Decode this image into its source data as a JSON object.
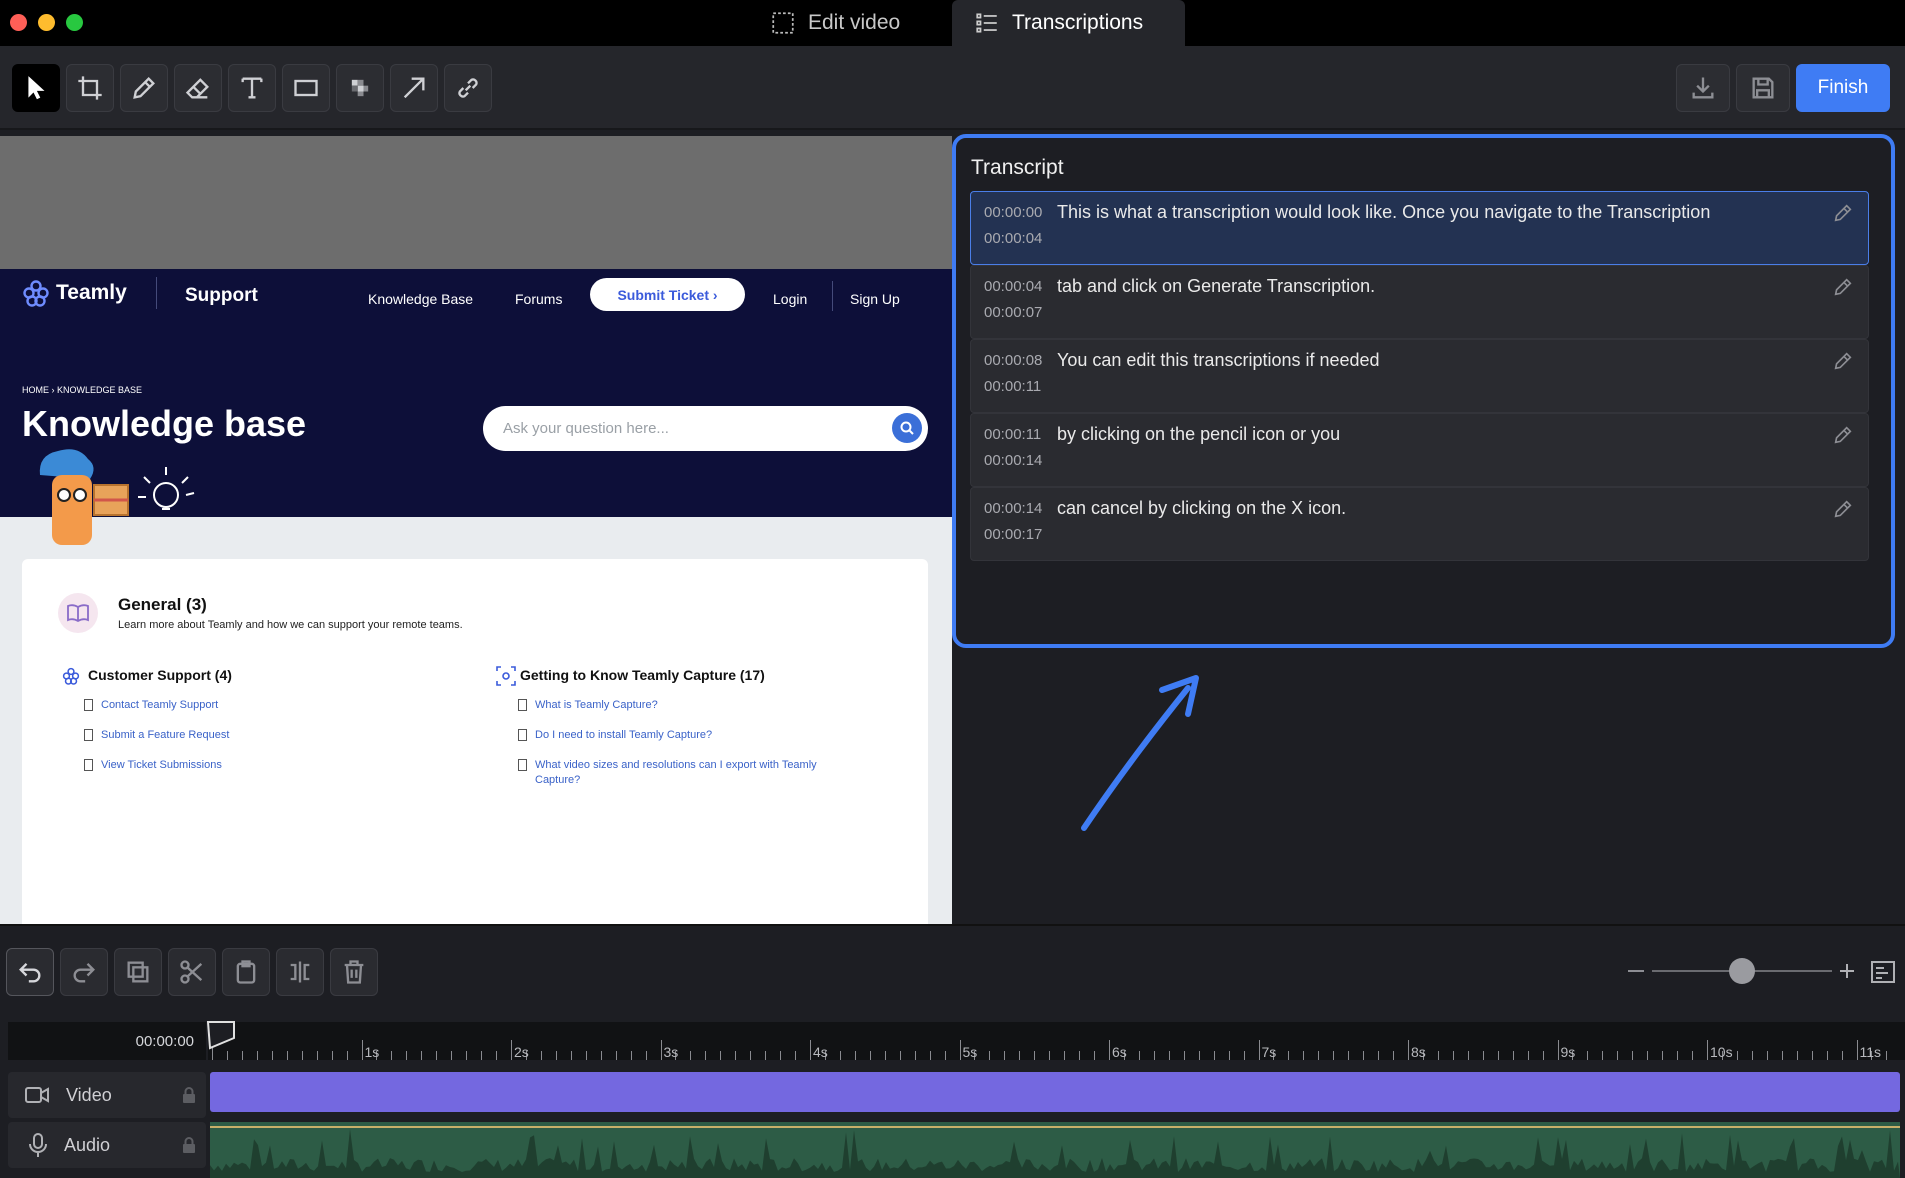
{
  "window": {
    "tabs": [
      {
        "label": "Edit video",
        "icon": "select-region-icon"
      },
      {
        "label": "Transcriptions",
        "icon": "list-icon"
      }
    ],
    "active_tab": "Transcriptions"
  },
  "toolbar": {
    "tools": [
      "cursor-tool",
      "crop-tool",
      "pen-tool",
      "eraser-tool",
      "text-tool",
      "rectangle-tool",
      "blur-tool",
      "arrow-tool",
      "link-tool"
    ],
    "finish_label": "Finish"
  },
  "preview": {
    "site": {
      "brand": "Teamly",
      "section": "Support",
      "nav": [
        "Knowledge Base",
        "Forums",
        "Submit Ticket ›",
        "Login",
        "Sign Up"
      ],
      "breadcrumb": "HOME  ›  KNOWLEDGE BASE",
      "heading": "Knowledge base",
      "search_placeholder": "Ask your question here...",
      "general_title": "General (3)",
      "general_sub": "Learn more about Teamly and how we can support your remote teams.",
      "categories": [
        {
          "title": "Customer Support (4)",
          "articles": [
            "Contact Teamly Support",
            "Submit a Feature Request",
            "View Ticket Submissions"
          ]
        },
        {
          "title": "Getting to Know Teamly Capture (17)",
          "articles": [
            "What is Teamly Capture?",
            "Do I need to install Teamly Capture?",
            "What video sizes and resolutions can I export with Teamly Capture?"
          ]
        }
      ]
    },
    "volume_level": 0.85
  },
  "transcript": {
    "title": "Transcript",
    "segments": [
      {
        "start": "00:00:00",
        "end": "00:00:04",
        "text": "This is what a transcription would look like. Once you navigate to the Transcription"
      },
      {
        "start": "00:00:04",
        "end": "00:00:07",
        "text": "tab and click on Generate Transcription."
      },
      {
        "start": "00:00:08",
        "end": "00:00:11",
        "text": "You can edit this transcriptions if needed"
      },
      {
        "start": "00:00:11",
        "end": "00:00:14",
        "text": "by clicking on the pencil icon or you"
      },
      {
        "start": "00:00:14",
        "end": "00:00:17",
        "text": "can cancel by clicking on the X icon."
      }
    ]
  },
  "timeline": {
    "current_time": "00:00:00",
    "ruler_labels": [
      "1s",
      "2s",
      "3s",
      "4s",
      "5s",
      "6s",
      "7s",
      "8s",
      "9s",
      "10s",
      "11s"
    ],
    "tracks": [
      {
        "label": "Video",
        "icon": "video-camera-icon"
      },
      {
        "label": "Audio",
        "icon": "microphone-icon"
      }
    ],
    "zoom_level": 0.5
  },
  "colors": {
    "accent": "#3f7cf4",
    "video_track": "#7468e0",
    "audio_track": "#2d5c46",
    "site_header": "#0d0f39"
  }
}
